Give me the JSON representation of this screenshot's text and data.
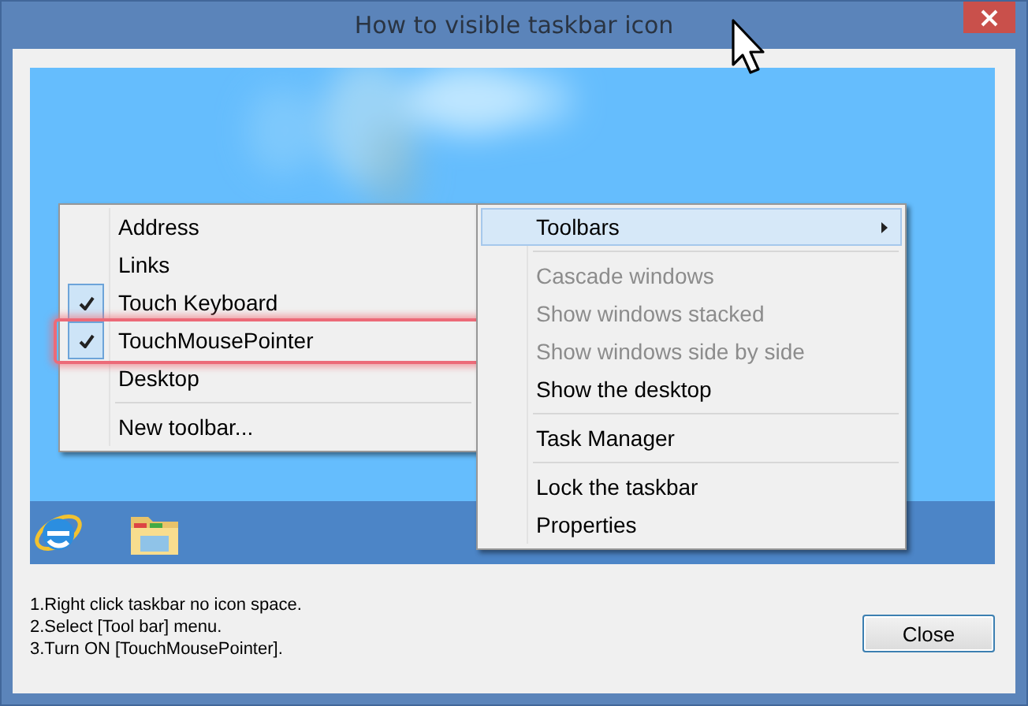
{
  "window": {
    "title": "How to visible taskbar icon"
  },
  "toolbars_menu": {
    "items": [
      {
        "kind": "item",
        "label": "Address",
        "checked": false,
        "highlighted": false
      },
      {
        "kind": "item",
        "label": "Links",
        "checked": false,
        "highlighted": false
      },
      {
        "kind": "item",
        "label": "Touch Keyboard",
        "checked": true,
        "highlighted": false
      },
      {
        "kind": "item",
        "label": "TouchMousePointer",
        "checked": true,
        "highlighted": true
      },
      {
        "kind": "item",
        "label": "Desktop",
        "checked": false,
        "highlighted": false
      },
      {
        "kind": "separator"
      },
      {
        "kind": "item",
        "label": "New toolbar...",
        "checked": false,
        "highlighted": false
      }
    ]
  },
  "context_menu": {
    "items": [
      {
        "kind": "submenu",
        "label": "Toolbars",
        "selected": true,
        "disabled": false
      },
      {
        "kind": "separator"
      },
      {
        "kind": "item",
        "label": "Cascade windows",
        "selected": false,
        "disabled": true
      },
      {
        "kind": "item",
        "label": "Show windows stacked",
        "selected": false,
        "disabled": true
      },
      {
        "kind": "item",
        "label": "Show windows side by side",
        "selected": false,
        "disabled": true
      },
      {
        "kind": "item",
        "label": "Show the desktop",
        "selected": false,
        "disabled": false
      },
      {
        "kind": "separator"
      },
      {
        "kind": "item",
        "label": "Task Manager",
        "selected": false,
        "disabled": false
      },
      {
        "kind": "separator"
      },
      {
        "kind": "item",
        "label": "Lock the taskbar",
        "selected": false,
        "disabled": false
      },
      {
        "kind": "item",
        "label": "Properties",
        "selected": false,
        "disabled": false
      }
    ]
  },
  "instructions": [
    "1.Right click taskbar no icon space.",
    "2.Select [Tool bar] menu.",
    "3.Turn ON [TouchMousePointer]."
  ],
  "buttons": [
    {
      "label": "Close"
    }
  ]
}
